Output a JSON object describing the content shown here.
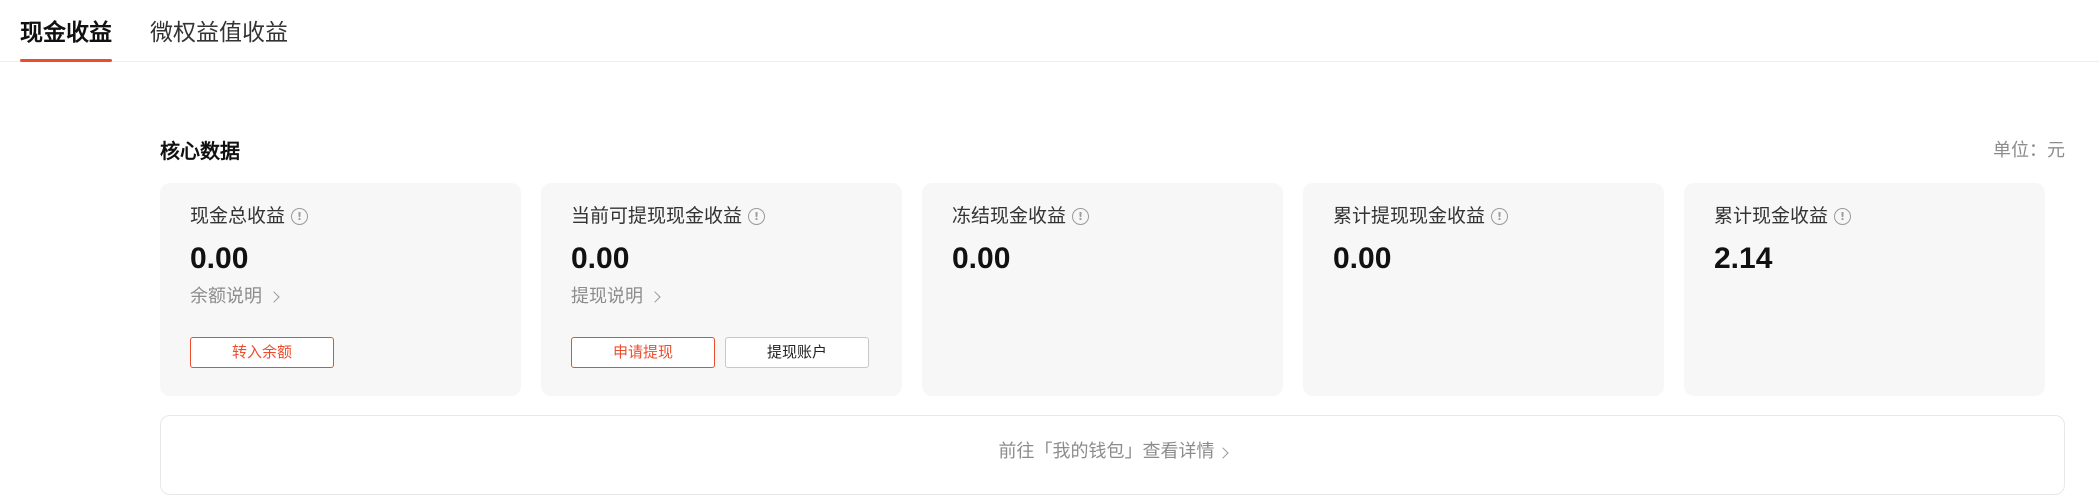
{
  "tabs": [
    {
      "label": "现金收益",
      "active": true
    },
    {
      "label": "微权益值收益",
      "active": false
    }
  ],
  "section": {
    "title": "核心数据",
    "unit": "单位：元"
  },
  "cards": [
    {
      "label": "现金总收益",
      "value": "0.00",
      "link": "余额说明",
      "buttons": [
        "转入余额"
      ]
    },
    {
      "label": "当前可提现现金收益",
      "value": "0.00",
      "link": "提现说明",
      "buttons": [
        "申请提现",
        "提现账户"
      ]
    },
    {
      "label": "冻结现金收益",
      "value": "0.00"
    },
    {
      "label": "累计提现现金收益",
      "value": "0.00"
    },
    {
      "label": "累计现金收益",
      "value": "2.14"
    }
  ],
  "footer": {
    "link": "前往「我的钱包」查看详情"
  },
  "icons": {
    "info": "info-circle-icon",
    "chevron": "chevron-right-icon"
  },
  "colors": {
    "accent": "#ee4d2d",
    "card_bg": "#f7f7f7",
    "muted_text": "#8c8c8c"
  }
}
